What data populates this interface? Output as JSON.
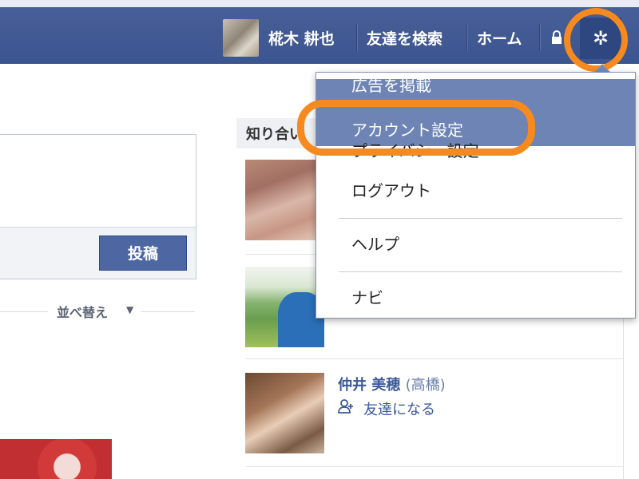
{
  "header": {
    "user_name": "椛木 耕也",
    "find_friends": "友達を検索",
    "home": "ホーム",
    "icons": [
      "lock-icon",
      "gear-icon"
    ],
    "bar_color": "#3b5590",
    "highlight_color": "#f68a1e"
  },
  "composer": {
    "post_button": "投稿",
    "sort_label": "並べ替え"
  },
  "people_you_may_know": {
    "title": "知り合い",
    "friend": {
      "name": "仲井 美穂",
      "maiden_name": "(高橋)",
      "add_friend": "友達になる"
    }
  },
  "settings_menu": {
    "items": [
      "広告を掲載",
      "アカウント設定",
      "プライバシー設定",
      "ログアウト",
      "ヘルプ",
      "ナビ"
    ],
    "selected": "アカウント設定",
    "selected_color": "#6d84b4"
  }
}
